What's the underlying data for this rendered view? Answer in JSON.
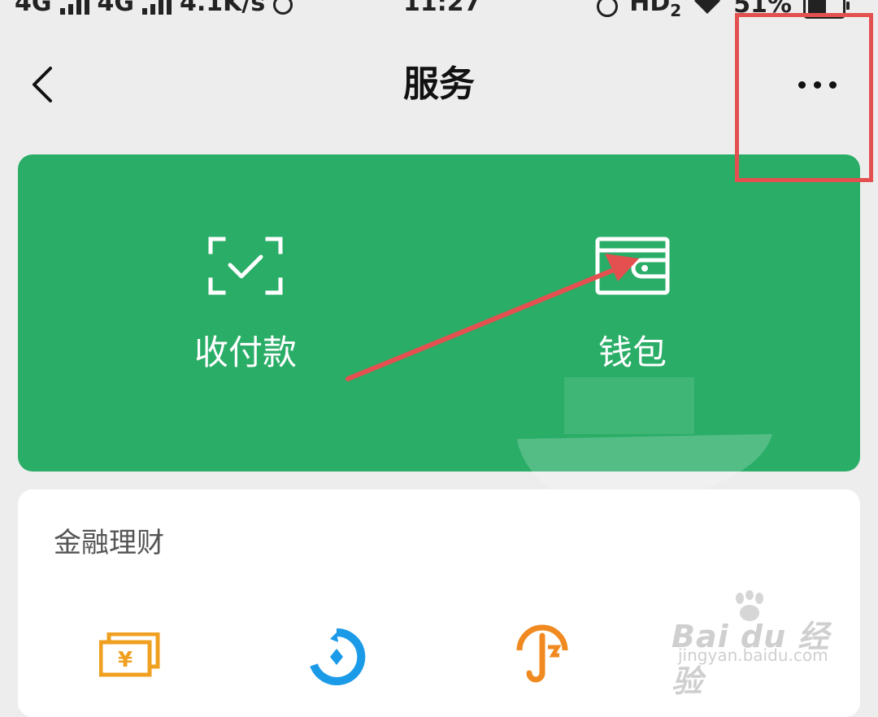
{
  "status_bar": {
    "network_1": "4G",
    "network_2": "4G",
    "speed": "4.1K/s",
    "time": "11:27",
    "hd": "HD",
    "hd_sub": "2",
    "battery": "51%"
  },
  "header": {
    "title": "服务"
  },
  "service_card": {
    "color": "#2aad67",
    "items": [
      {
        "label": "收付款",
        "icon": "scan-check-icon"
      },
      {
        "label": "钱包",
        "icon": "wallet-icon"
      }
    ]
  },
  "finance": {
    "title": "金融理财",
    "icons": [
      "cash-yuan-icon",
      "wealth-coin-icon",
      "insurance-umbrella-icon"
    ]
  },
  "watermark": {
    "main": "Bai du 经验",
    "sub": "jingyan.baidu.com"
  },
  "annotation_color": "#e4504f"
}
